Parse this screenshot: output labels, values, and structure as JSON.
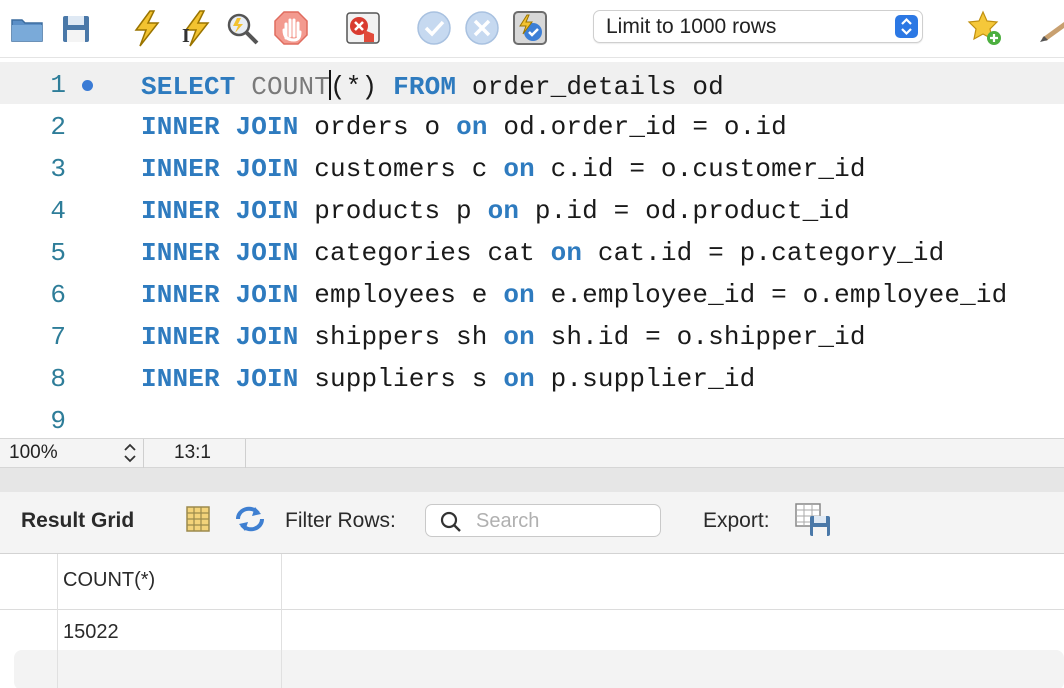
{
  "toolbar": {
    "icons": [
      "open-folder-icon",
      "save-icon",
      "execute-icon",
      "execute-current-icon",
      "explain-icon",
      "stop-icon",
      "toggle-error-icon",
      "commit-icon",
      "rollback-icon",
      "autocommit-icon",
      "add-snippet-icon",
      "beautify-icon"
    ],
    "limit_select": "Limit to 1000 rows"
  },
  "editor": {
    "lines": [
      {
        "no": "1",
        "tokens": [
          [
            "kw",
            "SELECT"
          ],
          [
            "t",
            " "
          ],
          [
            "fn",
            "COUNT"
          ],
          [
            "caret",
            ""
          ],
          [
            "t",
            "(*) "
          ],
          [
            "kw",
            "FROM"
          ],
          [
            "t",
            " order_details od"
          ]
        ]
      },
      {
        "no": "2",
        "tokens": [
          [
            "kw",
            "INNER JOIN"
          ],
          [
            "t",
            " orders o "
          ],
          [
            "kw",
            "on"
          ],
          [
            "t",
            " od.order_id = o.id"
          ]
        ]
      },
      {
        "no": "3",
        "tokens": [
          [
            "kw",
            "INNER JOIN"
          ],
          [
            "t",
            " customers c "
          ],
          [
            "kw",
            "on"
          ],
          [
            "t",
            " c.id = o.customer_id"
          ]
        ]
      },
      {
        "no": "4",
        "tokens": [
          [
            "kw",
            "INNER JOIN"
          ],
          [
            "t",
            " products p "
          ],
          [
            "kw",
            "on"
          ],
          [
            "t",
            " p.id = od.product_id"
          ]
        ]
      },
      {
        "no": "5",
        "tokens": [
          [
            "kw",
            "INNER JOIN"
          ],
          [
            "t",
            " categories cat "
          ],
          [
            "kw",
            "on"
          ],
          [
            "t",
            " cat.id = p.category_id"
          ]
        ]
      },
      {
        "no": "6",
        "tokens": [
          [
            "kw",
            "INNER JOIN"
          ],
          [
            "t",
            " employees e "
          ],
          [
            "kw",
            "on"
          ],
          [
            "t",
            " e.employee_id = o.employee_id"
          ]
        ]
      },
      {
        "no": "7",
        "tokens": [
          [
            "kw",
            "INNER JOIN"
          ],
          [
            "t",
            " shippers sh "
          ],
          [
            "kw",
            "on"
          ],
          [
            "t",
            " sh.id = o.shipper_id"
          ]
        ]
      },
      {
        "no": "8",
        "tokens": [
          [
            "kw",
            "INNER JOIN"
          ],
          [
            "t",
            " suppliers s "
          ],
          [
            "kw",
            "on"
          ],
          [
            "t",
            " p.supplier_id"
          ]
        ]
      },
      {
        "no": "9",
        "tokens": []
      }
    ]
  },
  "statusbar": {
    "zoom": "100%",
    "cursor_position": "13:1"
  },
  "result": {
    "title": "Result Grid",
    "filter_label": "Filter Rows:",
    "search_placeholder": "Search",
    "export_label": "Export:",
    "columns": [
      "COUNT(*)"
    ],
    "rows": [
      [
        "15022"
      ],
      [
        ""
      ]
    ]
  },
  "colors": {
    "keyword": "#2e7bbf",
    "line_number": "#2e7d99",
    "accent": "#2c78e4"
  }
}
